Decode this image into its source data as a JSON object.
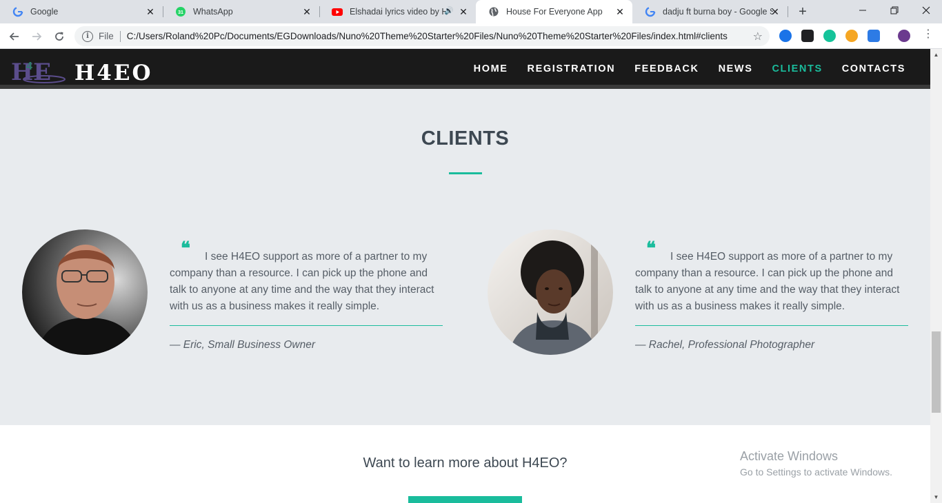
{
  "browser": {
    "tabs": [
      {
        "title": "Google",
        "icon": "google-icon"
      },
      {
        "title": "WhatsApp",
        "icon": "whatsapp-icon",
        "badge": "31"
      },
      {
        "title": "Elshadai lyrics video by H-",
        "icon": "youtube-icon"
      },
      {
        "title": "House For Everyone App",
        "icon": "globe-icon",
        "active": true
      },
      {
        "title": "dadju ft burna boy - Google Se",
        "icon": "google-icon"
      }
    ],
    "address": {
      "scheme": "File",
      "url": "C:/Users/Roland%20Pc/Documents/EGDownloads/Nuno%20Theme%20Starter%20Files/Nuno%20Theme%20Starter%20Files/index.html#clients"
    }
  },
  "site": {
    "brand": "H4EO",
    "nav": [
      "HOME",
      "REGISTRATION",
      "FEEDBACK",
      "NEWS",
      "CLIENTS",
      "CONTACTS"
    ],
    "active_nav": "CLIENTS"
  },
  "clients": {
    "title": "CLIENTS",
    "testimonials": [
      {
        "quote": "I see H4EO support as more of a partner to my company than a resource. I can pick up the phone and talk to anyone at any time and the way that they interact with us as a business makes it really simple.",
        "author": "— Eric, Small Business Owner"
      },
      {
        "quote": "I see H4EO support as more of a partner to my company than a resource. I can pick up the phone and talk to anyone at any time and the way that they interact with us as a business makes it really simple.",
        "author": "— Rachel, Professional Photographer"
      }
    ]
  },
  "cta": {
    "text": "Want to learn more about H4EO?"
  },
  "watermark": {
    "line1": "Activate Windows",
    "line2": "Go to Settings to activate Windows."
  },
  "colors": {
    "accent": "#1abc9c",
    "nav_bg": "#1a1a1a",
    "section_bg": "#e8ebee"
  }
}
